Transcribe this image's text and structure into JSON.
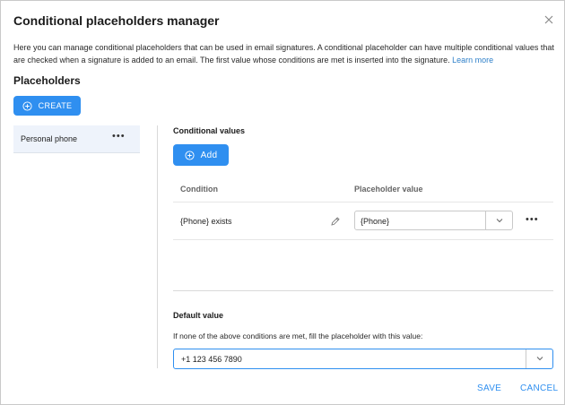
{
  "dialog": {
    "title": "Conditional placeholders manager",
    "description": "Here you can manage conditional placeholders that can be used in email signatures. A conditional placeholder can have multiple conditional values that are checked when a signature is added to an email. The first value whose conditions are met is inserted into the signature.",
    "learn_more": "Learn more",
    "close_icon": "close-icon"
  },
  "placeholders": {
    "heading": "Placeholders",
    "create_label": "CREATE",
    "items": [
      {
        "label": "Personal phone",
        "menu": "•••"
      }
    ]
  },
  "conditional_values": {
    "heading": "Conditional values",
    "add_label": "Add",
    "columns": {
      "condition": "Condition",
      "value": "Placeholder value"
    },
    "rows": [
      {
        "condition": "{Phone} exists",
        "value": "{Phone}",
        "menu": "•••"
      }
    ]
  },
  "default_value": {
    "heading": "Default value",
    "description": "If none of the above conditions are met, fill the placeholder with this value:",
    "value": "+1 123 456 7890"
  },
  "footer": {
    "save_label": "SAVE",
    "cancel_label": "CANCEL"
  },
  "colors": {
    "accent": "#2f8ff0",
    "selected_row": "#eef3fb",
    "link": "#2f80c9"
  }
}
